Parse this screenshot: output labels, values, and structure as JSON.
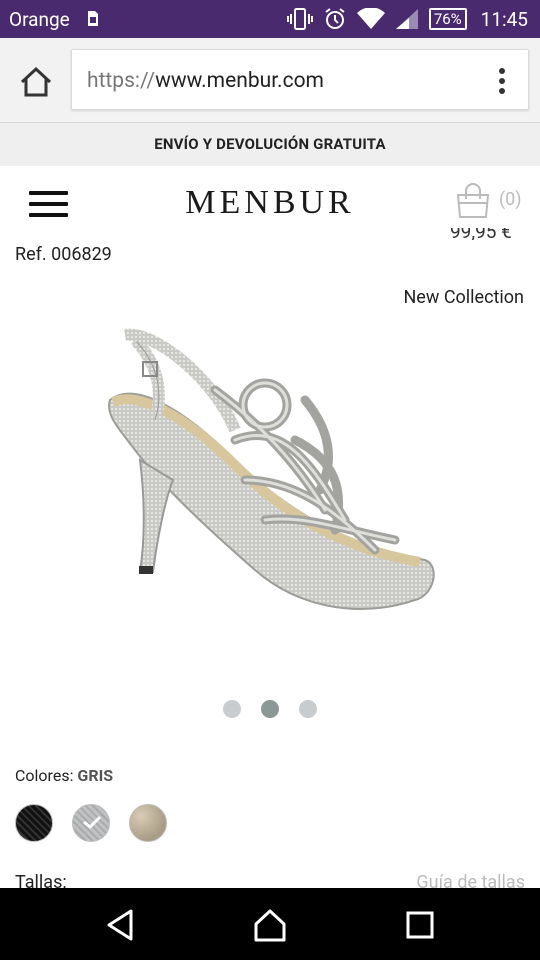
{
  "status_bar": {
    "carrier": "Orange",
    "battery": "76%",
    "time": "11:45",
    "icons": [
      "sim-icon",
      "vibrate-icon",
      "alarm-icon",
      "wifi-icon",
      "signal-icon",
      "battery-icon"
    ]
  },
  "browser": {
    "url_scheme": "https://",
    "url_host": "www.menbur.com",
    "home_icon": "home-icon",
    "menu_icon": "overflow-menu-icon"
  },
  "promo": {
    "text": "ENVÍO Y DEVOLUCIÓN GRATUITA"
  },
  "header": {
    "logo": "MENBUR",
    "cart_count": "(0)",
    "menu_icon": "hamburger-icon",
    "cart_icon": "shopping-bag-icon"
  },
  "product": {
    "price_partial": "99,95 €",
    "ref": "Ref. 006829",
    "badge": "New Collection",
    "image_alt": "silver glitter strappy high-heel sandal",
    "carousel": {
      "count": 3,
      "active_index": 1
    },
    "colors_label": "Colores:",
    "selected_color": "GRIS",
    "color_swatches": [
      {
        "name": "black",
        "selected": false
      },
      {
        "name": "grey",
        "selected": true
      },
      {
        "name": "gold",
        "selected": false
      }
    ],
    "sizes_label": "Tallas:",
    "size_guide": "Guía de tallas"
  },
  "colors": {
    "status_bar_bg": "#4a2a6e",
    "dot_active": "#8a9896",
    "dot_inactive": "#c9ccce"
  },
  "navbar": {
    "icons": [
      "back-icon",
      "home-icon",
      "recents-icon"
    ]
  }
}
